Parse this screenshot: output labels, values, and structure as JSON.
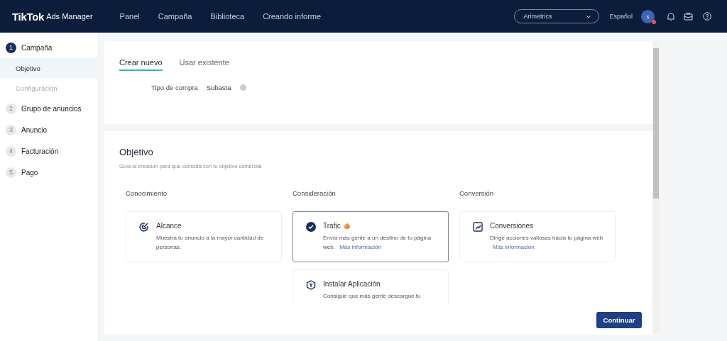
{
  "header": {
    "logo": "TikTok",
    "logo_suffix": "Ads Manager",
    "nav": [
      "Panel",
      "Campaña",
      "Biblioteca",
      "Creando informe"
    ],
    "account": "Arimetrics",
    "language": "Español",
    "avatar": "s",
    "avatar_alert": true
  },
  "sidebar": {
    "steps": [
      {
        "number": "1",
        "label": "Campaña",
        "selected": true,
        "children": [
          {
            "label": "Objetivo",
            "selected": true,
            "disabled": false
          },
          {
            "label": "Configuración",
            "selected": false,
            "disabled": true
          }
        ]
      },
      {
        "number": "2",
        "label": "Grupo de anuncios",
        "selected": false
      },
      {
        "number": "3",
        "label": "Anuncio",
        "selected": false
      },
      {
        "number": "4",
        "label": "Facturación",
        "selected": false
      },
      {
        "number": "5",
        "label": "Pago",
        "selected": false
      }
    ]
  },
  "tabs": [
    {
      "label": "Crear nuevo",
      "selected": true
    },
    {
      "label": "Usar existente",
      "selected": false
    }
  ],
  "purchase": {
    "label": "Tipo de compra",
    "value": "Subasta"
  },
  "objective": {
    "title": "Objetivo",
    "subtitle": "Guía la creación para que coincida con tu objetivo comercial",
    "groups": [
      {
        "label": "Conocimiento",
        "options": [
          {
            "kind": "reach",
            "title": "Alcance",
            "hot": false,
            "selected": false,
            "description": "Muestra tu anuncio a la mayor cantidad de personas."
          }
        ]
      },
      {
        "label": "Consideración",
        "options": [
          {
            "kind": "traffic",
            "title": "Trafic",
            "hot": true,
            "selected": true,
            "description": "Envía más gente a un destino de tu página web.",
            "link": "Más información"
          },
          {
            "kind": "app",
            "title": "Instalar Aplicación",
            "hot": false,
            "selected": false,
            "description": "Consigue que más gente descargue tu"
          }
        ]
      },
      {
        "label": "Conversión",
        "options": [
          {
            "kind": "conversion",
            "title": "Conversiones",
            "hot": false,
            "selected": false,
            "description": "Dirige acciones valiosas hacia tu página web",
            "link": "Más información",
            "link_break": true
          }
        ]
      }
    ]
  },
  "footer": {
    "button": "Continuar"
  }
}
